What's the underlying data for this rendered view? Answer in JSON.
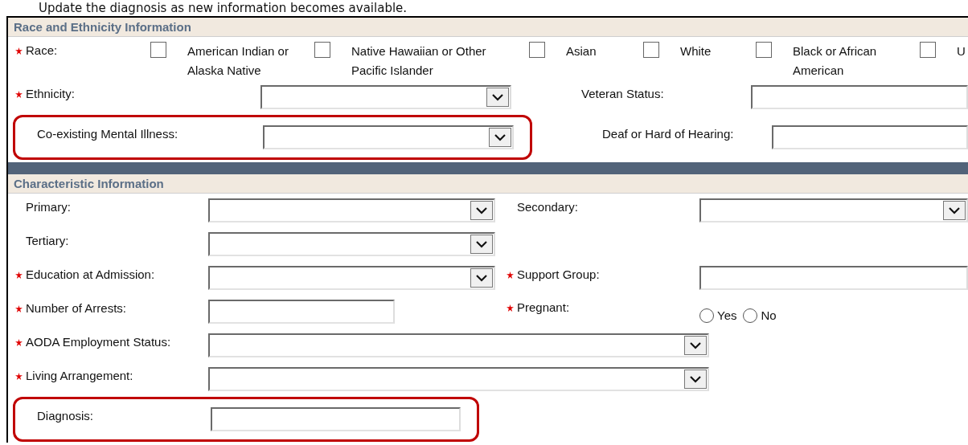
{
  "caption": "Update the diagnosis as new information becomes available.",
  "sections": [
    {
      "title": "Race and Ethnicity Information",
      "rows": [
        {
          "kind": "checkboxes",
          "label": "Race:",
          "required": true,
          "options": [
            {
              "label": "American Indian or Alaska Native",
              "checked": false
            },
            {
              "label": "Native Hawaiian or Other Pacific Islander",
              "checked": false
            },
            {
              "label": "Asian",
              "checked": false
            },
            {
              "label": "White",
              "checked": false
            },
            {
              "label": "Black or African American",
              "checked": false
            },
            {
              "label": "U",
              "checked": false
            }
          ]
        },
        {
          "kind": "fields",
          "fields": [
            {
              "label": "Ethnicity:",
              "required": true,
              "kind": "select",
              "highlighted": false
            },
            {
              "label": "Veteran Status:",
              "required": false,
              "kind": "text",
              "highlighted": false
            }
          ]
        },
        {
          "kind": "fields",
          "fields": [
            {
              "label": "Co-existing Mental Illness:",
              "required": false,
              "kind": "select",
              "highlighted": true
            },
            {
              "label": "Deaf or Hard of Hearing:",
              "required": false,
              "kind": "text",
              "highlighted": false
            }
          ]
        }
      ]
    },
    {
      "title": "Characteristic Information",
      "rows": [
        {
          "kind": "fields",
          "fields": [
            {
              "label": "Primary:",
              "required": false,
              "kind": "select",
              "highlighted": false
            },
            {
              "label": "Secondary:",
              "required": false,
              "kind": "select",
              "highlighted": false
            }
          ]
        },
        {
          "kind": "fields",
          "fields": [
            {
              "label": "Tertiary:",
              "required": false,
              "kind": "select",
              "highlighted": false
            }
          ]
        },
        {
          "kind": "fields",
          "fields": [
            {
              "label": "Education at Admission:",
              "required": true,
              "kind": "select",
              "highlighted": false
            },
            {
              "label": "Support Group:",
              "required": true,
              "kind": "text",
              "highlighted": false
            }
          ]
        },
        {
          "kind": "fields",
          "fields": [
            {
              "label": "Number of Arrests:",
              "required": true,
              "kind": "text",
              "highlighted": false
            },
            {
              "label": "Pregnant:",
              "required": true,
              "kind": "radio",
              "highlighted": false,
              "options": [
                {
                  "label": "Yes",
                  "selected": false
                },
                {
                  "label": "No",
                  "selected": false
                }
              ]
            }
          ]
        },
        {
          "kind": "fields",
          "fields": [
            {
              "label": "AODA Employment Status:",
              "required": true,
              "kind": "select",
              "highlighted": false
            }
          ]
        },
        {
          "kind": "fields",
          "fields": [
            {
              "label": "Living Arrangement:",
              "required": true,
              "kind": "select",
              "highlighted": false
            }
          ]
        },
        {
          "kind": "fields",
          "fields": [
            {
              "label": "Diagnosis:",
              "required": false,
              "kind": "text",
              "highlighted": true
            }
          ]
        }
      ]
    }
  ]
}
